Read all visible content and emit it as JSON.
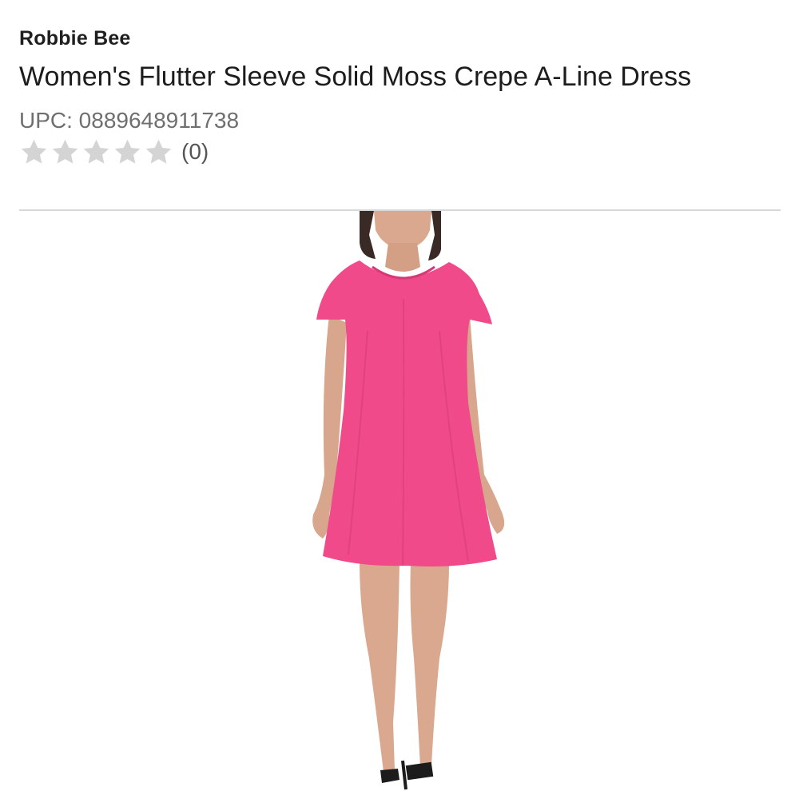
{
  "product": {
    "brand": "Robbie Bee",
    "title": "Women's Flutter Sleeve Solid Moss Crepe A-Line Dress",
    "upc_text": "UPC: 0889648911738",
    "rating_stars": 0,
    "rating_max": 5,
    "review_count_text": "(0)",
    "image_icon": "product-photo-pink-dress"
  },
  "colors": {
    "dress": "#f04a8a",
    "star_empty": "#d4d4d4",
    "divider": "#d8d8d8"
  }
}
